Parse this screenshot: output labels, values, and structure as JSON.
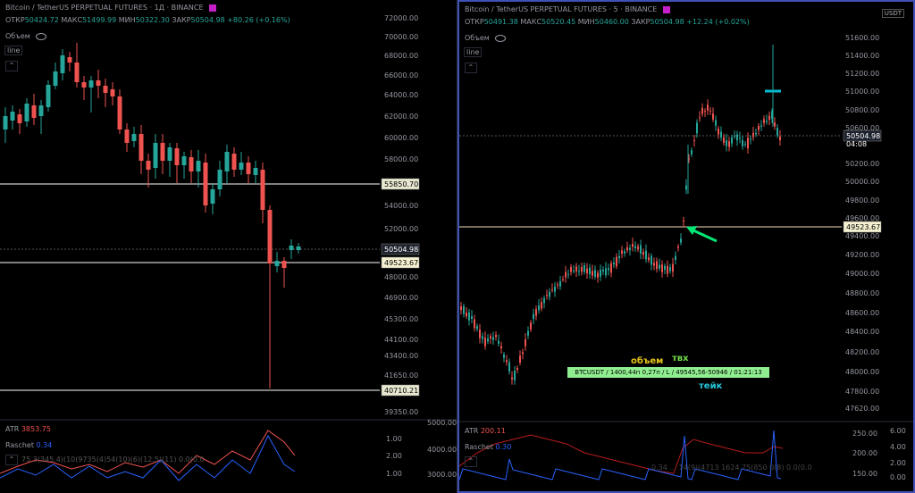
{
  "left": {
    "header": {
      "title": "Bitcoin / TetherUS PERPETUAL FUTURES · 1Д · BINANCE",
      "o_label": "ОТКР",
      "o": "50424.72",
      "h_label": "МАКС",
      "h": "51499.99",
      "l_label": "МИН",
      "l": "50322.30",
      "c_label": "ЗАКР",
      "c": "50504.98",
      "change": "+80.26 (+0.16%)"
    },
    "volume_label": "Объем",
    "line_label": "line",
    "price_axis": [
      "72000.00",
      "70000.00",
      "68000.00",
      "66000.00",
      "64000.00",
      "62000.00",
      "60000.00",
      "58000.00",
      "54000.00",
      "52000.00",
      "48000.00",
      "46900.00",
      "45300.00",
      "44100.00",
      "43400.00",
      "41650.00",
      "39350.00"
    ],
    "price_tags": {
      "h1": "55850.70",
      "cur": "50504.98",
      "h2": "49523.67",
      "h3": "40710.21"
    },
    "atr_label": "ATR",
    "atr_value": "3853.75",
    "raschet_label": "Raschet",
    "raschet_value": "0.34",
    "ind_overlay": "75  3(345.4)(10(9735(4)54(10)(6)(12.5)(11)  0.0(0.0",
    "ind_axis_left": [
      "1.00",
      "2.00",
      "1.00"
    ],
    "ind_axis_right": [
      "5000.00",
      "4000.00",
      "3000.00"
    ]
  },
  "right": {
    "header": {
      "title": "Bitcoin / TetherUS PERPETUAL FUTURES · 5 · BINANCE",
      "o_label": "ОТКР",
      "o": "50491.38",
      "h_label": "МАКС",
      "h": "50520.45",
      "l_label": "МИН",
      "l": "50460.00",
      "c_label": "ЗАКР",
      "c": "50504.98",
      "change": "+12.24 (+0.02%)"
    },
    "volume_label": "Объем",
    "line_label": "line",
    "usdt": "USDT",
    "price_axis": [
      "51600.00",
      "51400.00",
      "51200.00",
      "51000.00",
      "50800.00",
      "50600.00",
      "50200.00",
      "50000.00",
      "49800.00",
      "49600.00",
      "49400.00",
      "49200.00",
      "49000.00",
      "48800.00",
      "48600.00",
      "48400.00",
      "48200.00",
      "48000.00",
      "47800.00",
      "47620.00"
    ],
    "price_tag_cur": "50504.98",
    "price_tag_timer": "04:08",
    "price_tag_line": "49523.67",
    "annotation_obem": "объем",
    "annotation_tvh": "твх",
    "annotation_teik": "тейк",
    "trade_box": "BTCUSDT / 1400,44п 0,27п / L / 49545,56-50946 / 01:21:13",
    "atr_label": "ATR",
    "atr_value": "200.11",
    "raschet_label": "Raschet",
    "raschet_value": "0.30",
    "ind_overlay": "0.34  ... 14(9)(4713  1624  75(850  0(8)  0.0(0.0",
    "ind_axis_left": [
      "250.00",
      "200.00",
      "150.00"
    ],
    "ind_axis_right": [
      "6.00",
      "4.00",
      "2.00",
      "0.00"
    ]
  },
  "colors": {
    "up": "#26a69a",
    "down": "#ef5350",
    "hline": "#ffffff",
    "arrow": "#00e676",
    "cyan": "#00bcd4"
  }
}
